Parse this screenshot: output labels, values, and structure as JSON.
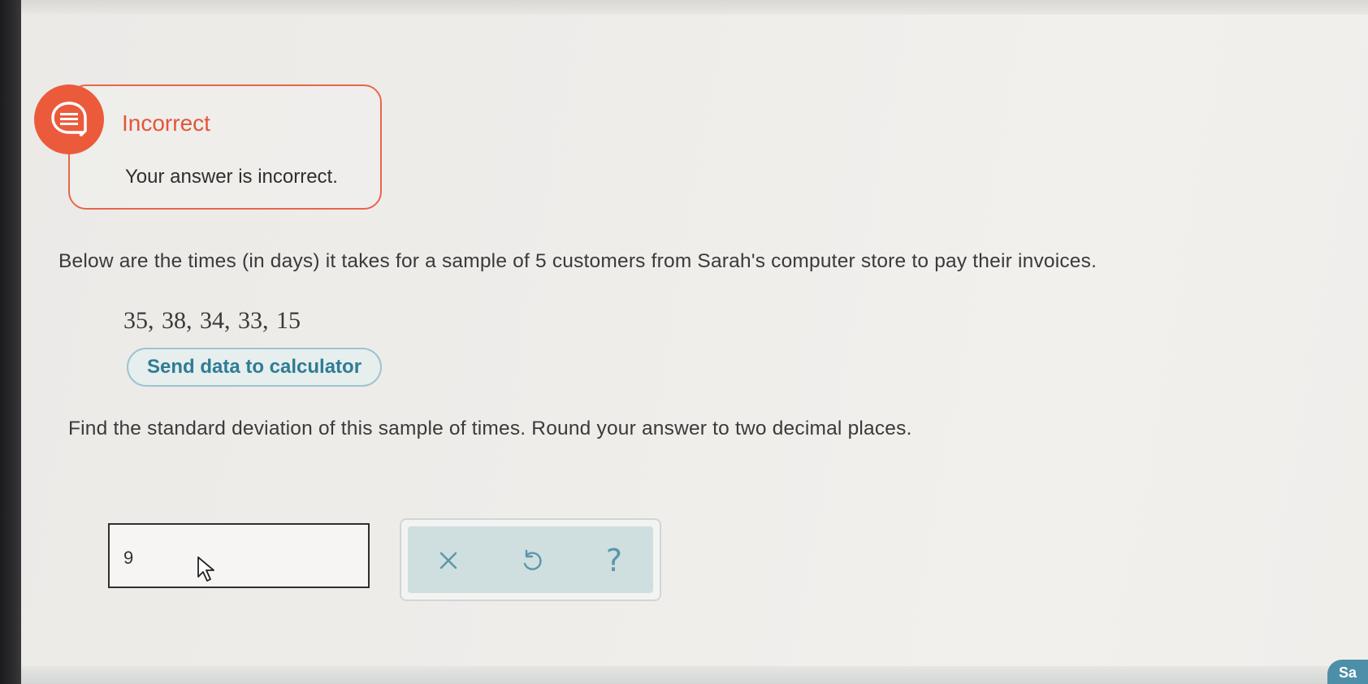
{
  "feedback": {
    "status": "Incorrect",
    "message": "Your answer is incorrect.",
    "icon": "speech-bubble-icon",
    "accent_color": "#ec5a3c"
  },
  "question": {
    "prompt": "Below are the times (in days) it takes for a sample of 5 customers from Sarah's computer store to pay their invoices.",
    "data_values": "35, 38, 34, 33, 15",
    "send_button_label": "Send data to calculator",
    "instruction": "Find the standard deviation of this sample of times. Round your answer to two decimal places."
  },
  "answer": {
    "value": "9"
  },
  "tools": {
    "clear_icon": "close-icon",
    "undo_icon": "undo-icon",
    "help_label": "?",
    "icon_color": "#5a96ad"
  },
  "corner_button": {
    "label": "Sa"
  }
}
